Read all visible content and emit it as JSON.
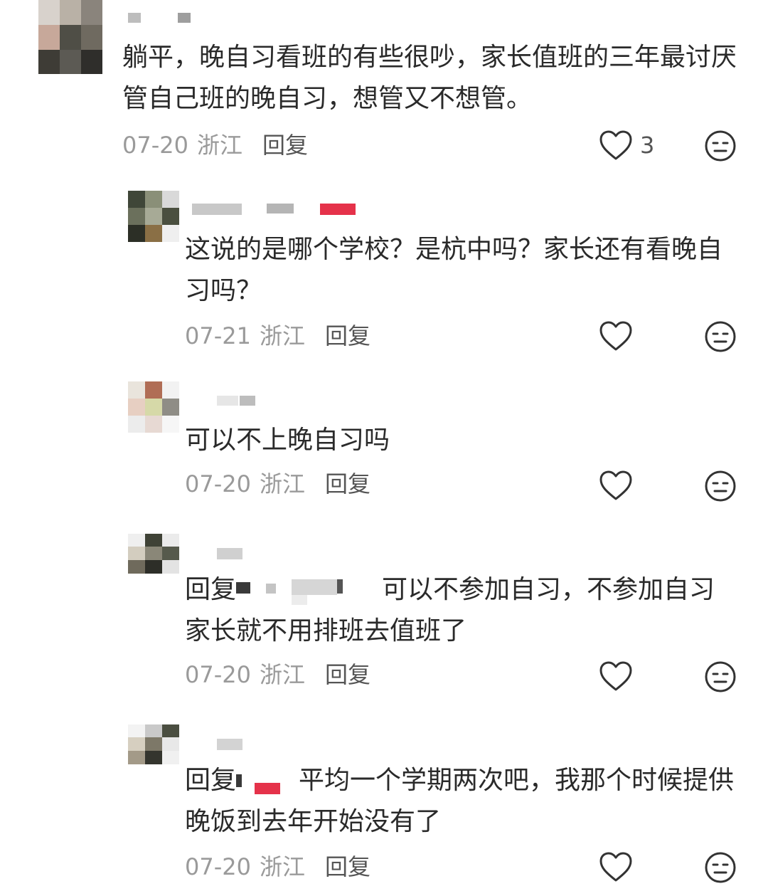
{
  "comments": [
    {
      "text": "躺平，晚自习看班的有些很吵，家长值班的三年最讨厌管自己班的晚自习，想管又不想管。",
      "date": "07-20",
      "location": "浙江",
      "reply": "回复",
      "likes": "3"
    },
    {
      "text": "这说的是哪个学校？是杭中吗？家长还有看晚自习吗？",
      "date": "07-21",
      "location": "浙江",
      "reply": "回复",
      "likes": ""
    },
    {
      "text": "可以不上晚自习吗",
      "date": "07-20",
      "location": "浙江",
      "reply": "回复",
      "likes": ""
    },
    {
      "prefix": "回复",
      "text": "可以不参加自习，不参加自习家长就不用排班去值班了",
      "date": "07-20",
      "location": "浙江",
      "reply": "回复",
      "likes": ""
    },
    {
      "prefix": "回复",
      "text": "平均一个学期两次吧，我那个时候提供晚饭到去年开始没有了",
      "date": "07-20",
      "location": "浙江",
      "reply": "回复",
      "likes": ""
    }
  ],
  "icons": {
    "like": "heart-outline-icon",
    "dislike": "unhappy-face-icon"
  },
  "colors": {
    "text": "#2a2a2a",
    "meta": "#9a9a9a",
    "icon": "#333333",
    "redacted_red": "#e5324a"
  }
}
